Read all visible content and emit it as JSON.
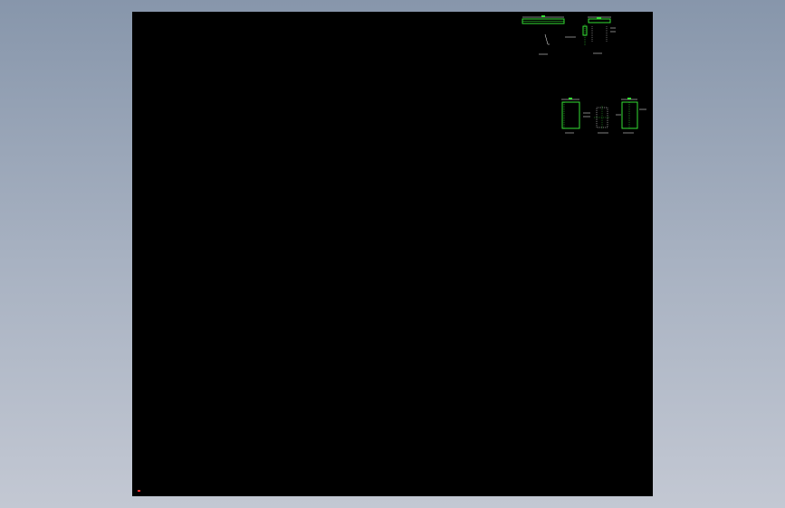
{
  "viewport": {
    "background_top": "#8796ab",
    "background_bottom": "#c3c8d3"
  },
  "sheet": {
    "background": "#000000"
  },
  "colors": {
    "outline": "#35e035",
    "dimension": "#ffffff",
    "origin": "#ff3030"
  },
  "views": [
    {
      "name": "view-1",
      "label": ""
    },
    {
      "name": "view-2",
      "label": ""
    },
    {
      "name": "view-3",
      "label": ""
    },
    {
      "name": "view-4",
      "label": ""
    },
    {
      "name": "view-5",
      "label": ""
    }
  ],
  "origin_marker": {
    "icon": "ucs-origin-icon"
  }
}
